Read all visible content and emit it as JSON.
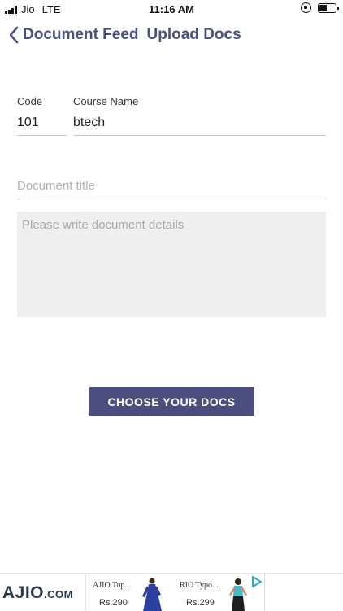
{
  "status_bar": {
    "carrier": "Jio",
    "network": "LTE",
    "time": "11:16 AM",
    "battery_level": 0.55
  },
  "nav": {
    "back_label": "Document Feed",
    "title": "Upload Docs",
    "accent_color": "#4b4e7f"
  },
  "form": {
    "code_label": "Code",
    "code_value": "101",
    "course_label": "Course Name",
    "course_value": "btech",
    "doc_title_placeholder": "Document title",
    "details_placeholder": "Please write document details",
    "choose_button": "CHOOSE YOUR DOCS"
  },
  "ad": {
    "brand": "AJIO",
    "brand_suffix": ".COM",
    "products": [
      {
        "name": "AJIO Top...",
        "price": "Rs.290",
        "image": "blue-dress"
      },
      {
        "name": "RIO Typo...",
        "price": "Rs.299",
        "image": "teal-top-model"
      }
    ],
    "adchoices_icon": "adchoices-icon"
  }
}
